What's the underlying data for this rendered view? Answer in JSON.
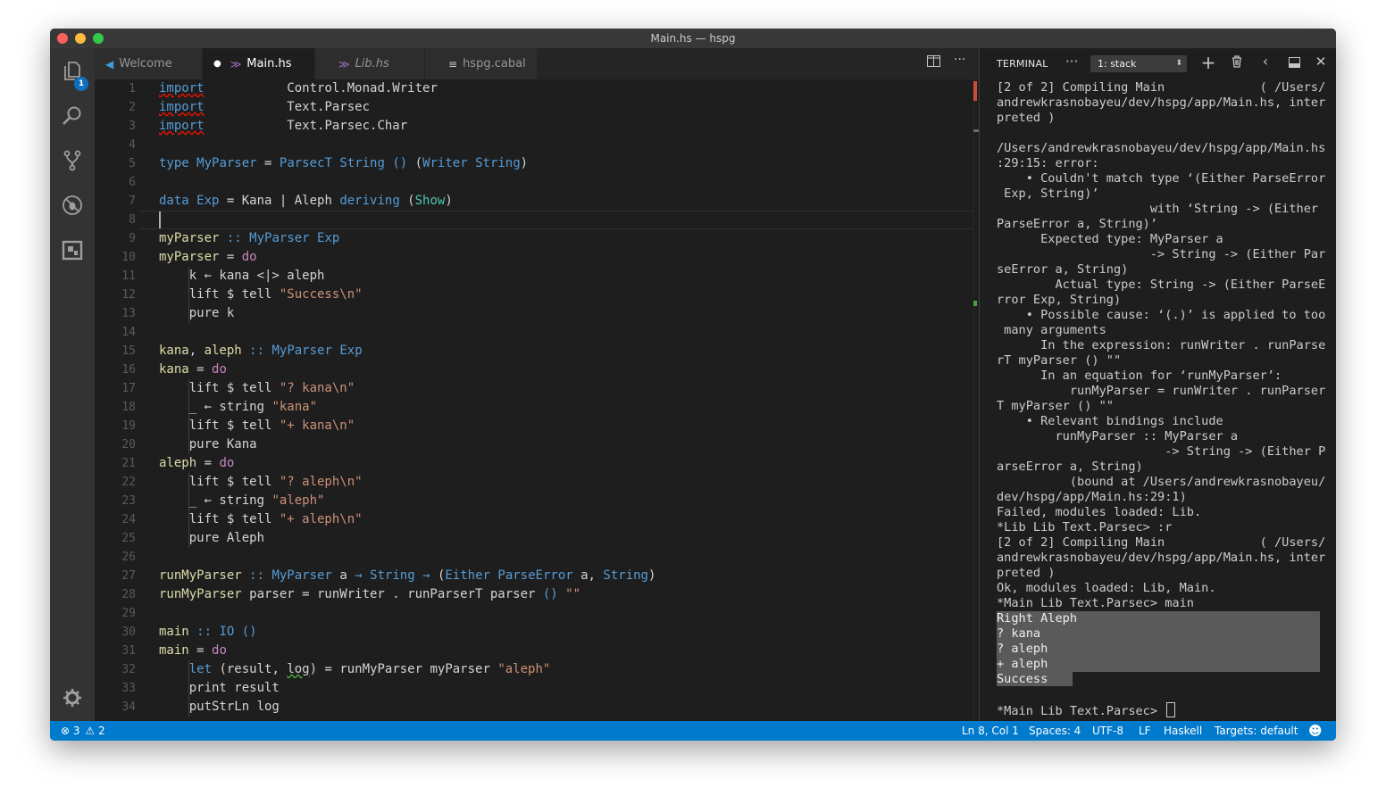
{
  "window": {
    "title": "Main.hs — hspg"
  },
  "activity_bar": {
    "items": [
      {
        "name": "explorer-icon",
        "badge": "1"
      },
      {
        "name": "search-icon"
      },
      {
        "name": "source-control-icon"
      },
      {
        "name": "debug-icon"
      },
      {
        "name": "extensions-icon"
      }
    ],
    "bottom": {
      "name": "settings-gear-icon"
    }
  },
  "tabs": [
    {
      "label": "Welcome",
      "icon": "vscode-logo-icon",
      "active": false,
      "dirty": false
    },
    {
      "label": "Main.hs",
      "icon": "haskell-icon",
      "active": true,
      "dirty": true
    },
    {
      "label": "Lib.hs",
      "icon": "haskell-icon",
      "active": false,
      "dirty": false
    },
    {
      "label": "hspg.cabal",
      "icon": "file-lines-icon",
      "active": false,
      "dirty": false
    }
  ],
  "editor": {
    "file": "Main.hs",
    "lines": [
      "import           Control.Monad.Writer",
      "import           Text.Parsec",
      "import           Text.Parsec.Char",
      "",
      "type MyParser = ParsecT String () (Writer String)",
      "",
      "data Exp = Kana | Aleph deriving (Show)",
      "",
      "myParser :: MyParser Exp",
      "myParser = do",
      "    k ← kana <|> aleph",
      "    lift $ tell \"Success\\n\"",
      "    pure k",
      "",
      "kana, aleph :: MyParser Exp",
      "kana = do",
      "    lift $ tell \"? kana\\n\"",
      "    _ ← string \"kana\"",
      "    lift $ tell \"+ kana\\n\"",
      "    pure Kana",
      "aleph = do",
      "    lift $ tell \"? aleph\\n\"",
      "    _ ← string \"aleph\"",
      "    lift $ tell \"+ aleph\\n\"",
      "    pure Aleph",
      "",
      "runMyParser :: MyParser a → String → (Either ParseError a, String)",
      "runMyParser parser = runWriter . runParserT parser () \"\"",
      "",
      "main :: IO ()",
      "main = do",
      "    let (result, log) = runMyParser myParser \"aleph\"",
      "    print result",
      "    putStrLn log"
    ]
  },
  "terminal": {
    "title": "TERMINAL",
    "more": "···",
    "selected": "1: stack",
    "lines": [
      "[2 of 2] Compiling Main             ( /Users/",
      "andrewkrasnobayeu/dev/hspg/app/Main.hs, inter",
      "preted )",
      "",
      "/Users/andrewkrasnobayeu/dev/hspg/app/Main.hs",
      ":29:15: error:",
      "    • Couldn't match type ‘(Either ParseError",
      " Exp, String)’",
      "                     with ‘String -> (Either",
      "ParseError a, String)’",
      "      Expected type: MyParser a",
      "                     -> String -> (Either Par",
      "seError a, String)",
      "        Actual type: String -> (Either ParseE",
      "rror Exp, String)",
      "    • Possible cause: ‘(.)’ is applied to too",
      " many arguments",
      "      In the expression: runWriter . runParse",
      "rT myParser () \"\"",
      "      In an equation for ‘runMyParser’:",
      "          runMyParser = runWriter . runParser",
      "T myParser () \"\"",
      "    • Relevant bindings include",
      "        runMyParser :: MyParser a",
      "                       -> String -> (Either P",
      "arseError a, String)",
      "          (bound at /Users/andrewkrasnobayeu/",
      "dev/hspg/app/Main.hs:29:1)",
      "Failed, modules loaded: Lib.",
      "*Lib Lib Text.Parsec> :r",
      "[2 of 2] Compiling Main             ( /Users/",
      "andrewkrasnobayeu/dev/hspg/app/Main.hs, inter",
      "preted )",
      "Ok, modules loaded: Lib, Main.",
      "*Main Lib Text.Parsec> main",
      "Right Aleph",
      "? kana",
      "? aleph",
      "+ aleph",
      "Success",
      "",
      "*Main Lib Text.Parsec> "
    ]
  },
  "status_bar": {
    "errors": "3",
    "warnings": "2",
    "position": "Ln 8, Col 1",
    "spaces": "Spaces: 4",
    "encoding": "UTF-8",
    "eol": "LF",
    "language": "Haskell",
    "targets": "Targets: default",
    "feedback_icon": "smiley-icon"
  },
  "colors": {
    "status_bar": "#007acc",
    "editor_bg": "#1e1e1e",
    "activity_bar": "#333333"
  }
}
